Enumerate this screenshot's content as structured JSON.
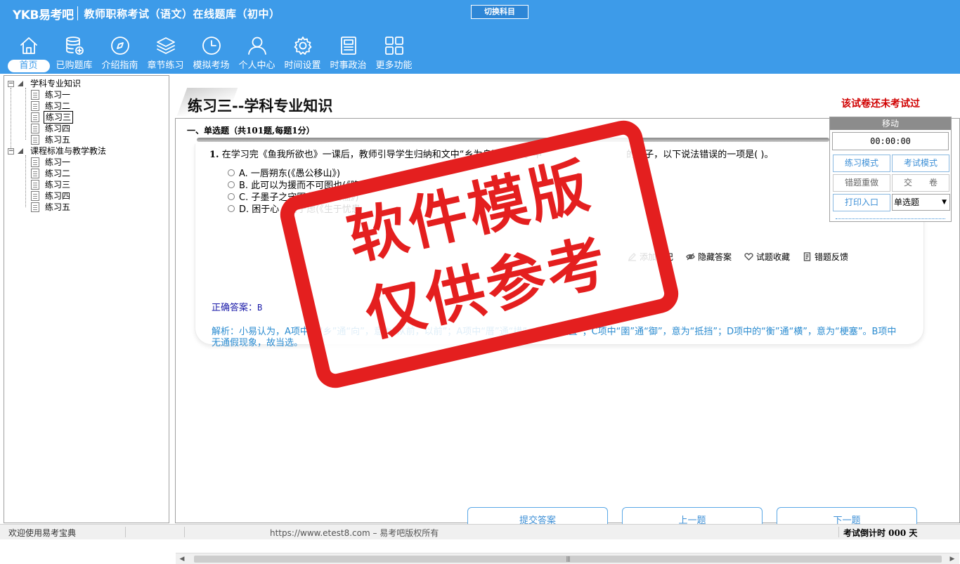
{
  "app": {
    "logo": "YKB易考吧",
    "title": "教师职称考试（语文）在线题库（初中）",
    "switch_subject": "切换科目"
  },
  "toolbar": [
    {
      "label": "首页",
      "icon": "home-icon",
      "active": true
    },
    {
      "label": "已购题库",
      "icon": "database-icon",
      "active": false
    },
    {
      "label": "介绍指南",
      "icon": "compass-icon",
      "active": false
    },
    {
      "label": "章节练习",
      "icon": "layers-icon",
      "active": false
    },
    {
      "label": "模拟考场",
      "icon": "clock-icon",
      "active": false
    },
    {
      "label": "个人中心",
      "icon": "user-icon",
      "active": false
    },
    {
      "label": "时间设置",
      "icon": "gear-icon",
      "active": false
    },
    {
      "label": "时事政治",
      "icon": "newspaper-icon",
      "active": false
    },
    {
      "label": "更多功能",
      "icon": "grid-icon",
      "active": false
    }
  ],
  "tree": {
    "groups": [
      {
        "label": "学科专业知识",
        "expanded": true,
        "items": [
          "练习一",
          "练习二",
          "练习三",
          "练习四",
          "练习五"
        ],
        "selected_index": 2
      },
      {
        "label": "课程标准与教学教法",
        "expanded": true,
        "items": [
          "练习一",
          "练习二",
          "练习三",
          "练习四",
          "练习五"
        ],
        "selected_index": -1
      }
    ]
  },
  "paper": {
    "title": "练习三--学科专业知识",
    "status": "该试卷还未考试过"
  },
  "section": {
    "heading": "一、单选题（共101题,每题1分）"
  },
  "question": {
    "number": "1.",
    "stem": "在学习完《鱼我所欲也》一课后，教师引导学生归纳和文中“乡为身死而不受”中",
    "stem_tail": "的句子，以下说法错误的一项是( )。",
    "options": [
      "A. 一唇朔东(《愚公移山》)",
      "B. 此可以为援而不可图也(《隆中对》)",
      "C. 子墨子之守圉有余(《公输》)",
      "D. 困于心，衡于虑(《生于忧患"
    ],
    "tools": [
      "添加笔记",
      "隐藏答案",
      "试题收藏",
      "错题反馈"
    ],
    "answer_label": "正确答案：",
    "answer_value": "B",
    "analysis": "解析：小易认为，A项中的“乡”通“向”，意为“从前，以前”；A项中“厝”通“措”，意为“放置”；C项中“圉”通“御”，意为“抵挡”；D项中的“衡”通“横”，意为“梗塞”。B项中无通假现象，故当选。"
  },
  "nav_buttons": {
    "submit": "提交答案",
    "prev": "上一题",
    "next": "下一题"
  },
  "control_panel": {
    "move": "移动",
    "timer": "00:00:00",
    "practice_mode": "练习模式",
    "exam_mode": "考试模式",
    "redo_wrong": "错题重做",
    "hand_in": "交　　卷",
    "print_entry": "打印入口",
    "question_type": "单选题"
  },
  "statusbar": {
    "welcome": "欢迎使用易考宝典",
    "copyright": "https://www.etest8.com – 易考吧版权所有",
    "countdown": "考试倒计时 000 天"
  },
  "watermark": {
    "line1": "软件模版",
    "line2": "仅供参考"
  },
  "colors": {
    "header_blue": "#3d9be9",
    "stamp_red": "#e41f1f",
    "status_red": "#d00000"
  }
}
